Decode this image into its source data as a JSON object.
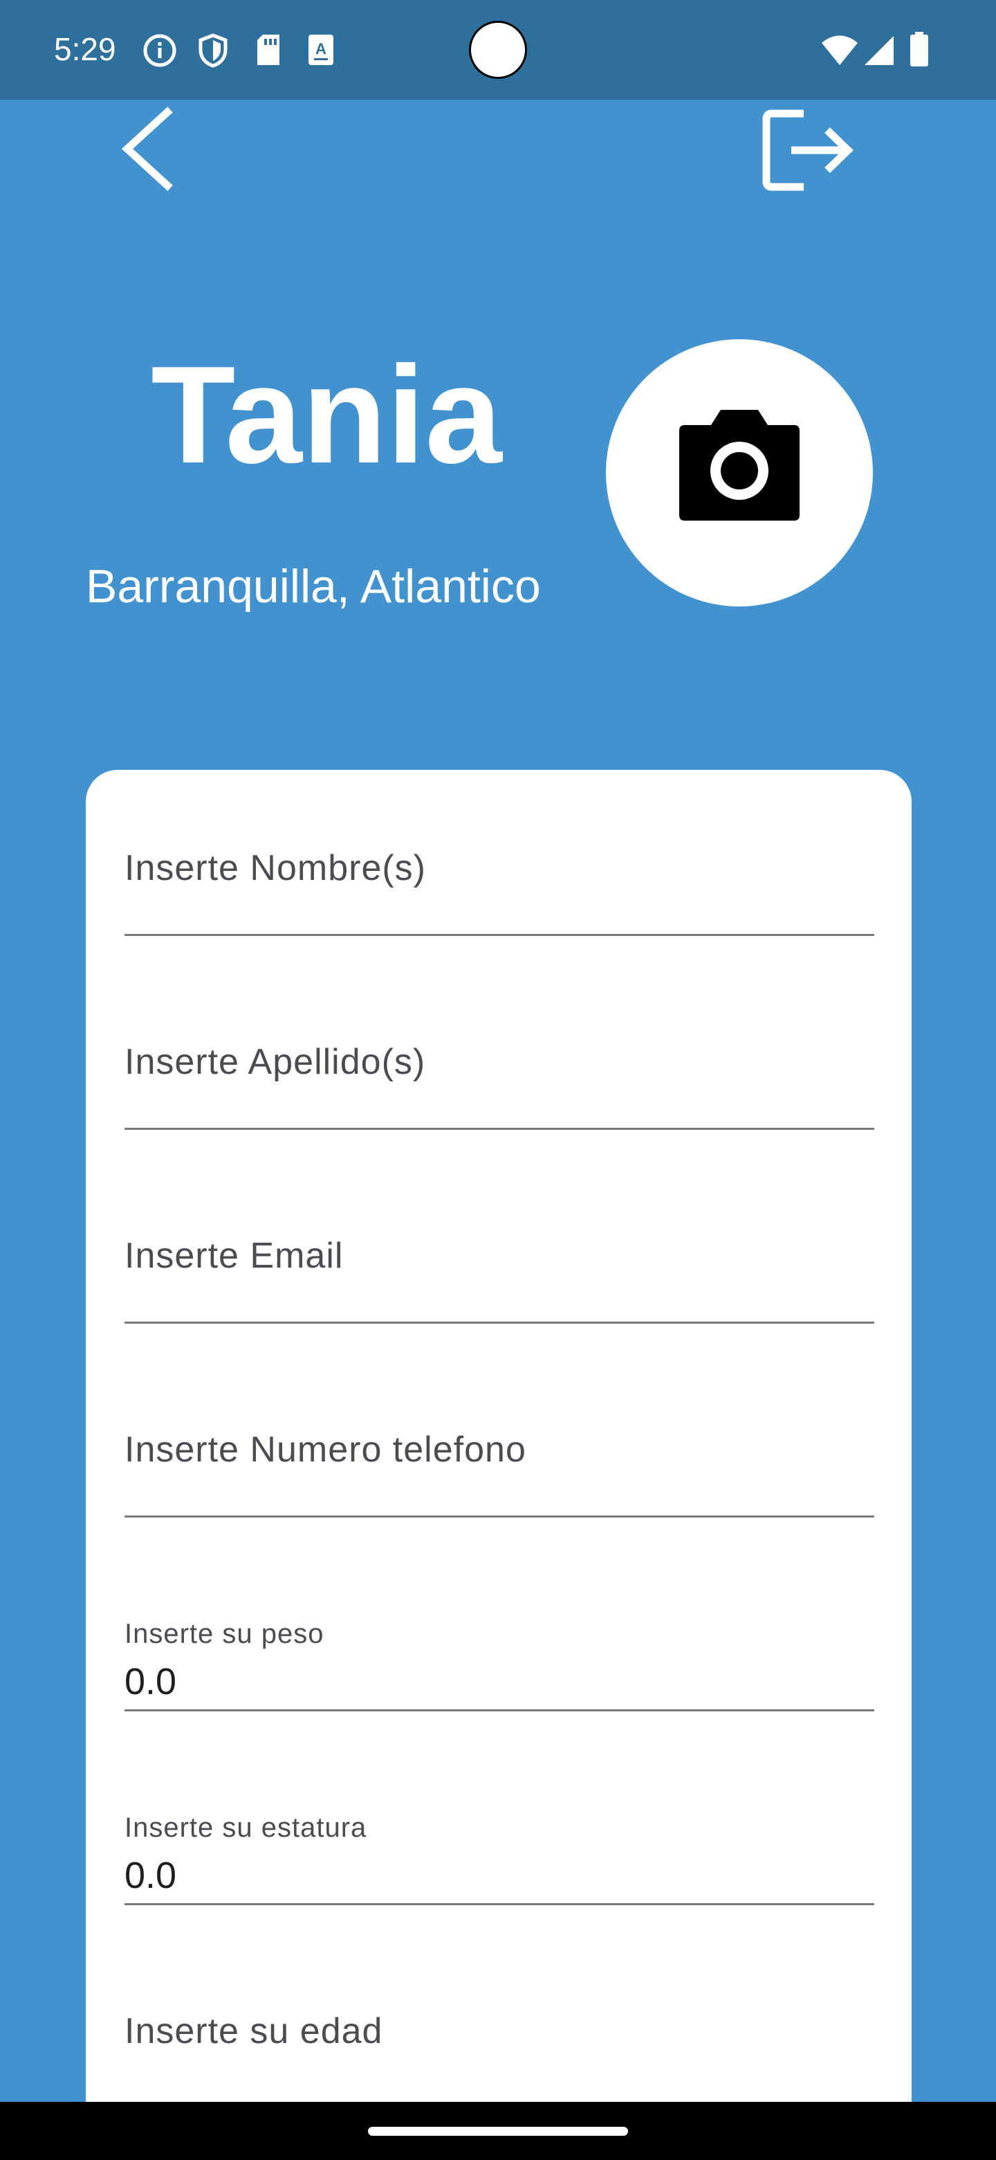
{
  "status_bar": {
    "time": "5:29",
    "left_icons": [
      "info-icon",
      "shield-icon",
      "sd-card-icon",
      "a-badge-icon"
    ],
    "right_icons": [
      "wifi-icon",
      "signal-icon",
      "battery-icon"
    ]
  },
  "header": {
    "back_icon": "chevron-left-icon",
    "logout_icon": "logout-icon"
  },
  "profile": {
    "name": "Tania",
    "location": "Barranquilla, Atlantico",
    "avatar_icon": "camera-icon"
  },
  "form": {
    "fields": [
      {
        "placeholder": "Inserte Nombre(s)",
        "value": ""
      },
      {
        "placeholder": "Inserte Apellido(s)",
        "value": ""
      },
      {
        "placeholder": "Inserte Email",
        "value": ""
      },
      {
        "placeholder": "Inserte Numero telefono",
        "value": ""
      },
      {
        "label": "Inserte su peso",
        "value": "0.0"
      },
      {
        "label": "Inserte su estatura",
        "value": "0.0"
      },
      {
        "placeholder": "Inserte su edad",
        "value": ""
      }
    ]
  },
  "colors": {
    "background": "#4192cf",
    "status_bar": "#2f6f9c",
    "card": "#ffffff"
  }
}
